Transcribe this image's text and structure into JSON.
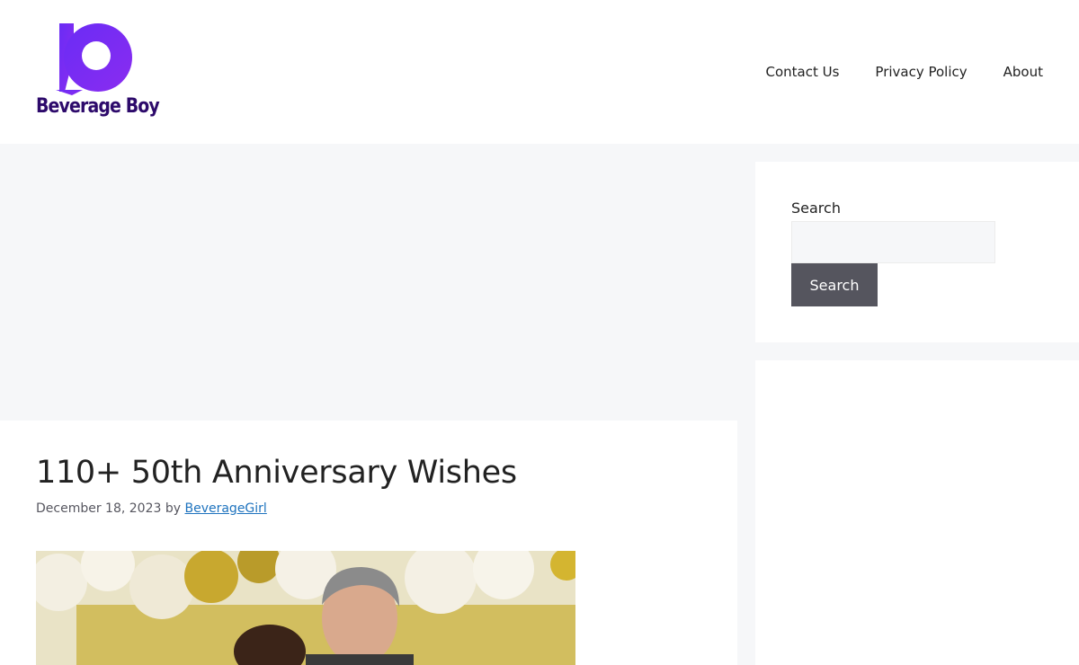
{
  "header": {
    "logo_text": "Beverage Boy",
    "nav": [
      {
        "label": "Contact Us"
      },
      {
        "label": "Privacy Policy"
      },
      {
        "label": "About"
      }
    ]
  },
  "sidebar": {
    "search": {
      "label": "Search",
      "input_value": "",
      "button_label": "Search"
    }
  },
  "article": {
    "title": "110+ 50th Anniversary Wishes",
    "date": "December 18, 2023",
    "by": "by",
    "author": "BeverageGirl"
  },
  "colors": {
    "brand_purple": "#7b2ff7",
    "logo_text": "#2d0a6b",
    "link": "#1e73be",
    "button": "#55555e",
    "page_bg": "#f6f7f9"
  },
  "icons": {
    "logo": "beverage-boy-logo-icon"
  }
}
